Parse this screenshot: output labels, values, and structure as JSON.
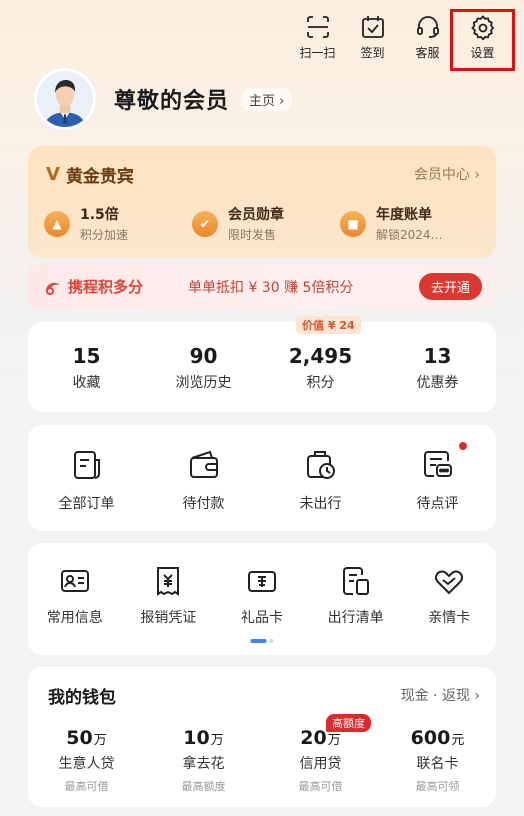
{
  "top_actions": [
    {
      "label": "扫一扫",
      "icon": "scan-icon"
    },
    {
      "label": "签到",
      "icon": "checkin-icon"
    },
    {
      "label": "客服",
      "icon": "headset-icon"
    },
    {
      "label": "设置",
      "icon": "settings-gear-icon"
    }
  ],
  "profile": {
    "name": "尊敬的会员",
    "homepage_label": "主页 ›"
  },
  "gold_card": {
    "title": "黄金贵宾",
    "member_center": "会员中心 ›",
    "perks": [
      {
        "title": "1.5倍",
        "subtitle": "积分加速",
        "icon": "rocket-icon"
      },
      {
        "title": "会员勋章",
        "subtitle": "限时发售",
        "icon": "medal-icon"
      },
      {
        "title": "年度账单",
        "subtitle": "解锁2024…",
        "icon": "gift-icon"
      }
    ]
  },
  "promo": {
    "brand": "携程积多分",
    "description": "单单抵扣 ¥ 30 赚 5倍积分",
    "button": "去开通"
  },
  "stats": {
    "value_badge": "价值 ¥ 24",
    "items": [
      {
        "value": "15",
        "label": "收藏"
      },
      {
        "value": "90",
        "label": "浏览历史"
      },
      {
        "value": "2,495",
        "label": "积分"
      },
      {
        "value": "13",
        "label": "优惠券"
      }
    ]
  },
  "orders": [
    {
      "label": "全部订单",
      "icon": "all-orders-icon"
    },
    {
      "label": "待付款",
      "icon": "wallet-pay-icon"
    },
    {
      "label": "未出行",
      "icon": "luggage-clock-icon"
    },
    {
      "label": "待点评",
      "icon": "review-icon"
    }
  ],
  "tools": [
    {
      "label": "常用信息",
      "icon": "id-card-icon"
    },
    {
      "label": "报销凭证",
      "icon": "receipt-icon"
    },
    {
      "label": "礼品卡",
      "icon": "gift-card-icon"
    },
    {
      "label": "出行清单",
      "icon": "checklist-icon"
    },
    {
      "label": "亲情卡",
      "icon": "family-card-icon"
    }
  ],
  "wallet": {
    "title": "我的钱包",
    "link": "现金 · 返现 ›",
    "high_badge": "高额度",
    "items": [
      {
        "amount": "50",
        "unit": "万",
        "name": "生意人贷",
        "sub": "最高可借"
      },
      {
        "amount": "10",
        "unit": "万",
        "name": "拿去花",
        "sub": "最高额度"
      },
      {
        "amount": "20",
        "unit": "万",
        "name": "信用贷",
        "sub": "最高可借"
      },
      {
        "amount": "600",
        "unit": "元",
        "name": "联名卡",
        "sub": "最高可领"
      }
    ]
  },
  "colors": {
    "brand_red": "#d93930",
    "gold_text": "#6b3a12",
    "accent_blue": "#3a82f7"
  }
}
